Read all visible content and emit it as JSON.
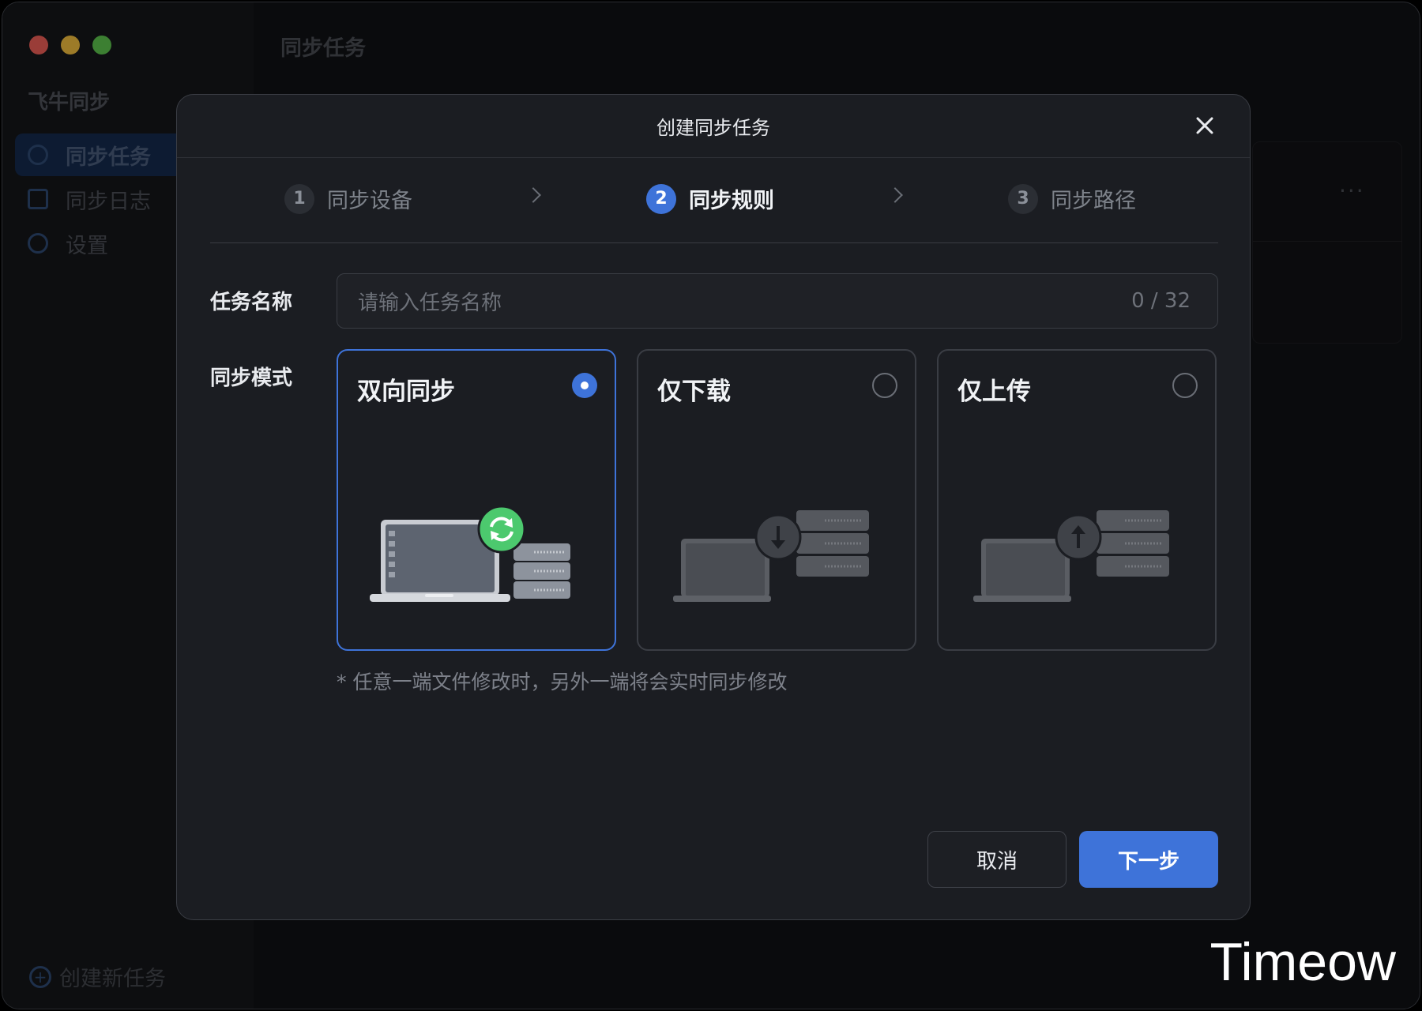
{
  "app": {
    "name": "飞牛同步"
  },
  "sidebar": {
    "items": [
      {
        "label": "同步任务",
        "icon": "sync-task-icon",
        "active": true
      },
      {
        "label": "同步日志",
        "icon": "log-document-icon",
        "active": false
      },
      {
        "label": "设置",
        "icon": "gear-icon",
        "active": false
      }
    ],
    "create_label": "创建新任务"
  },
  "main": {
    "title": "同步任务",
    "more_label": "···"
  },
  "dialog": {
    "title": "创建同步任务",
    "steps": [
      {
        "num": "1",
        "label": "同步设备",
        "active": false
      },
      {
        "num": "2",
        "label": "同步规则",
        "active": true
      },
      {
        "num": "3",
        "label": "同步路径",
        "active": false
      }
    ],
    "task_name": {
      "label": "任务名称",
      "placeholder": "请输入任务名称",
      "value": "",
      "counter": "0 / 32"
    },
    "sync_mode": {
      "label": "同步模式",
      "options": [
        {
          "label": "双向同步",
          "selected": true,
          "illustration": "two-way-sync-illustration"
        },
        {
          "label": "仅下载",
          "selected": false,
          "illustration": "download-only-illustration"
        },
        {
          "label": "仅上传",
          "selected": false,
          "illustration": "upload-only-illustration"
        }
      ],
      "hint": "* 任意一端文件修改时，另外一端将会实时同步修改"
    },
    "buttons": {
      "cancel": "取消",
      "next": "下一步"
    }
  },
  "watermark": "Timeow",
  "colors": {
    "accent": "#3e73d9",
    "sync_green": "#4cc96e",
    "dialog_bg": "#1b1d22"
  }
}
